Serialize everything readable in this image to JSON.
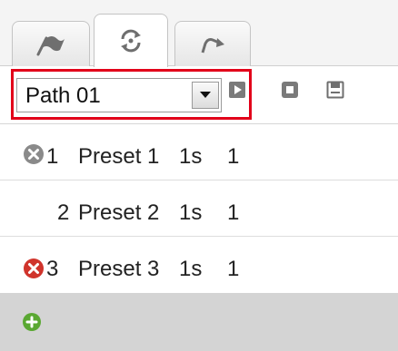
{
  "tabs": [
    {
      "name": "preset",
      "icon": "flag-icon",
      "active": false
    },
    {
      "name": "patrol",
      "icon": "cycle-arrows-icon",
      "active": true
    },
    {
      "name": "pattern",
      "icon": "redo-arrow-icon",
      "active": false
    }
  ],
  "toolbar": {
    "path_select": {
      "value": "Path 01",
      "icon": "chevron-down-icon"
    },
    "buttons": [
      {
        "name": "play",
        "icon": "play-icon"
      },
      {
        "name": "stop",
        "icon": "stop-icon"
      },
      {
        "name": "save",
        "icon": "save-icon"
      }
    ]
  },
  "presets": [
    {
      "number": "1",
      "name": "Preset 1",
      "duration": "1s",
      "speed": "1",
      "delete_icon": "delete-icon",
      "delete_color": "#8a8a8a"
    },
    {
      "number": "2",
      "name": "Preset 2",
      "duration": "1s",
      "speed": "1",
      "delete_icon": "",
      "delete_color": ""
    },
    {
      "number": "3",
      "name": "Preset 3",
      "duration": "1s",
      "speed": "1",
      "delete_icon": "delete-icon",
      "delete_color": "#d0342c"
    }
  ],
  "footer": {
    "add_icon": "add-icon",
    "add_color": "#5aa832"
  },
  "colors": {
    "highlight": "#e2001a",
    "footer_bg": "#d4d4d4",
    "icon_gray": "#7a7a7a"
  }
}
